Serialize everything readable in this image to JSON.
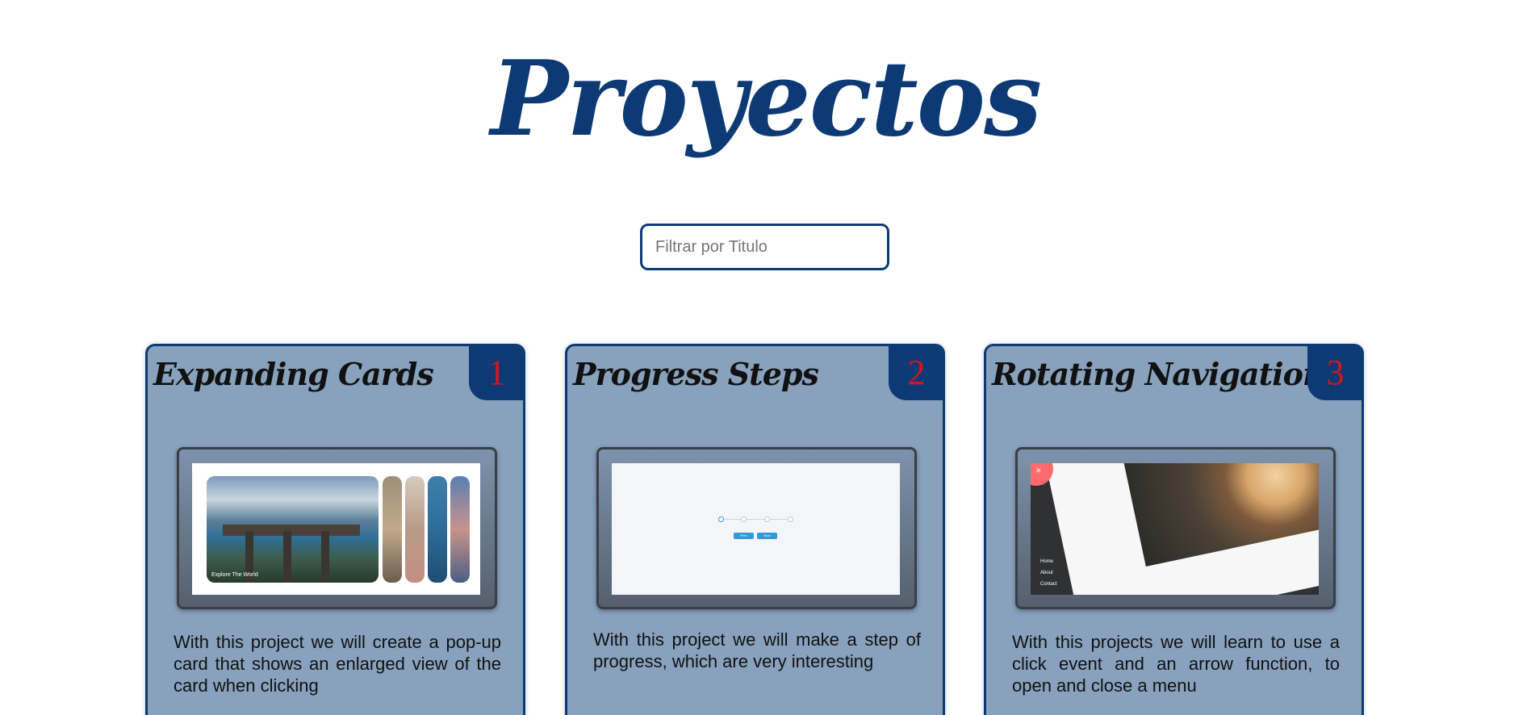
{
  "page": {
    "title": "Proyectos"
  },
  "filter": {
    "placeholder": "Filtrar por Titulo",
    "value": ""
  },
  "projects": [
    {
      "number": "1",
      "title": "Expanding Cards",
      "description": "With this project we will create a pop-up card that shows an enlarged view of the card when clicking",
      "preview": {
        "caption": "Explore The World"
      }
    },
    {
      "number": "2",
      "title": "Progress Steps",
      "description": "With this project we will make a step of progress, which are very interesting",
      "preview": {
        "prev_label": "Prev",
        "next_label": "Next"
      }
    },
    {
      "number": "3",
      "title": "Rotating Navigation",
      "description": "With this projects we will learn to use a click event and an arrow function, to open and close a menu",
      "preview": {
        "menu": [
          "Home",
          "About",
          "Contact"
        ]
      }
    }
  ],
  "colors": {
    "brand": "#0d3a75",
    "card_bg": "#88a1bd",
    "number": "#d3151e"
  }
}
